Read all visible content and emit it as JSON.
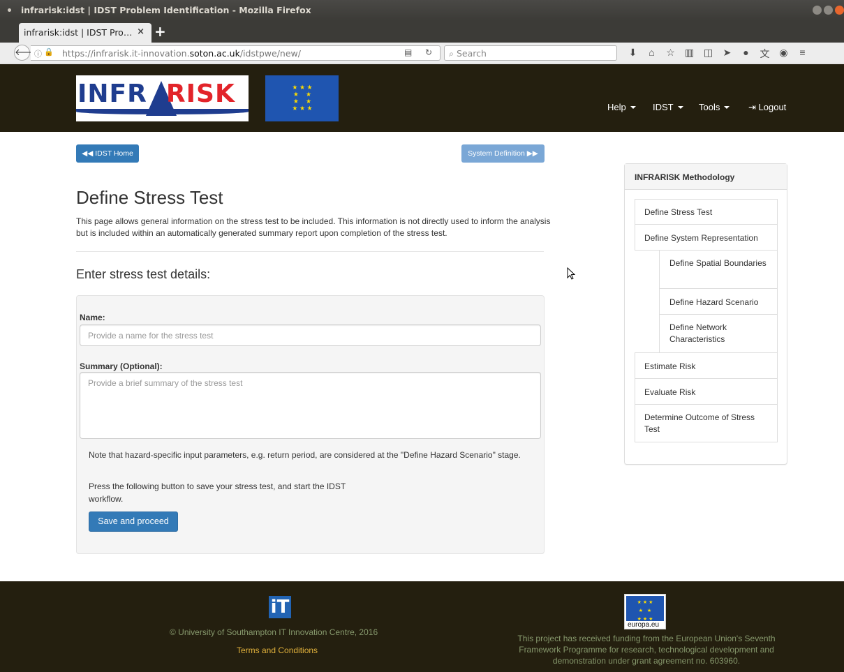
{
  "window": {
    "title": "infrarisk:idst | IDST Problem Identification - Mozilla Firefox"
  },
  "tab": {
    "label": "infrarisk:idst | IDST Pro…",
    "close": "×",
    "new": "+"
  },
  "navbar": {
    "back": "🡐",
    "url_prefix": "https://infrarisk.it-innovation.",
    "url_domain": "soton.ac.uk",
    "url_suffix": "/idstpwe/new/",
    "search_placeholder": "Search"
  },
  "site_nav": {
    "help": "Help",
    "idst": "IDST",
    "tools": "Tools",
    "logout": "Logout"
  },
  "logo": {
    "text_blue": "INFR",
    "text_red": "RISK"
  },
  "buttons": {
    "home": "IDST Home",
    "next": "System Definition"
  },
  "page": {
    "title": "Define Stress Test",
    "intro": "This page allows general information on the stress test to be included. This information is not directly used to inform the analysis but is included within an automatically generated summary report upon completion of the stress test.",
    "section_title": "Enter stress test details:"
  },
  "form": {
    "name_label": "Name:",
    "name_placeholder": "Provide a name for the stress test",
    "summary_label": "Summary (Optional):",
    "summary_placeholder": "Provide a brief summary of the stress test",
    "note": "Note that hazard-specific input parameters, e.g. return period, are considered at the \"Define Hazard Scenario\" stage.",
    "press_note": "Press the following button to save your stress test, and start the IDST workflow.",
    "save_label": "Save and proceed"
  },
  "sidebar": {
    "heading": "INFRARISK Methodology",
    "items": [
      "Define Stress Test",
      "Define System Representation",
      "Define Spatial Boundaries",
      "Define Hazard Scenario",
      "Define Network Characteristics",
      "Estimate Risk",
      "Evaluate Risk",
      "Determine Outcome of Stress Test"
    ]
  },
  "footer": {
    "it_logo": "iT",
    "copyright": "© University of Southampton IT Innovation Centre, 2016",
    "terms": "Terms and Conditions",
    "europa": "europa.eu",
    "funding": "This project has received funding from the European Union's Seventh Framework Programme for research, technological development and demonstration under grant agreement no. 603960."
  }
}
